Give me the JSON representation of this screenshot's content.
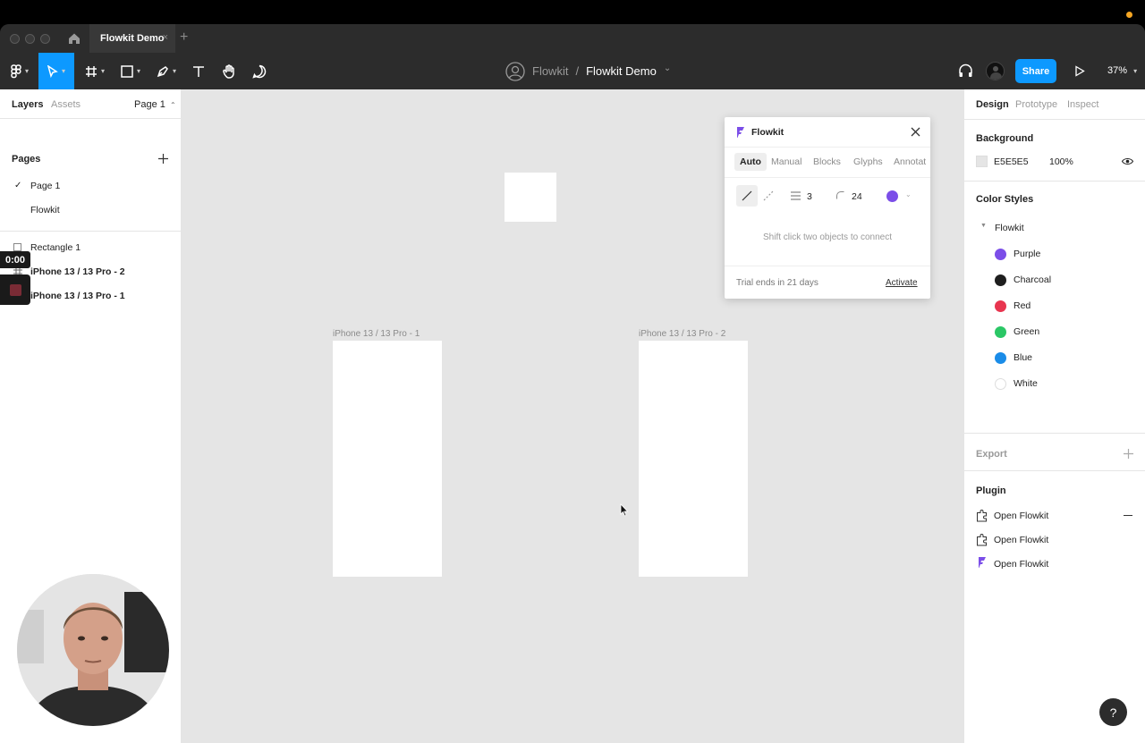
{
  "app": {
    "tab_title": "Flowkit Demo",
    "tab_close": "×",
    "new_tab": "+"
  },
  "toolbar": {
    "project": "Flowkit",
    "separator": "/",
    "file": "Flowkit Demo",
    "caret": "⌄",
    "share_label": "Share",
    "zoom": "37%"
  },
  "left_panel": {
    "tabs": {
      "layers": "Layers",
      "assets": "Assets",
      "page_selector": "Page 1"
    },
    "pages_title": "Pages",
    "pages": [
      {
        "label": "Page 1",
        "checked": true
      },
      {
        "label": "Flowkit",
        "checked": false
      }
    ],
    "layers": [
      {
        "label": "Rectangle 1",
        "type": "rectangle",
        "bold": false
      },
      {
        "label": "iPhone 13 / 13 Pro - 2",
        "type": "frame",
        "bold": true
      },
      {
        "label": "iPhone 13 / 13 Pro - 1",
        "type": "frame",
        "bold": true
      }
    ]
  },
  "canvas": {
    "background": "#E5E5E5",
    "frames": [
      {
        "label": "iPhone 13 / 13 Pro - 1"
      },
      {
        "label": "iPhone 13 / 13 Pro - 2"
      }
    ]
  },
  "plugin": {
    "title": "Flowkit",
    "tabs": [
      "Auto",
      "Manual",
      "Blocks",
      "Glyphs",
      "Annotat"
    ],
    "active_tab": "Auto",
    "stroke_width": "3",
    "corner_radius": "24",
    "connector_color": "#7B4EE8",
    "hint": "Shift click two objects to connect",
    "trial": "Trial ends in 21 days",
    "activate": "Activate"
  },
  "right_panel": {
    "tabs": {
      "design": "Design",
      "prototype": "Prototype",
      "inspect": "Inspect"
    },
    "background_title": "Background",
    "background_hex": "E5E5E5",
    "background_opacity": "100%",
    "color_styles_title": "Color Styles",
    "color_group": "Flowkit",
    "colors": [
      {
        "name": "Purple",
        "hex": "#7B4EE8"
      },
      {
        "name": "Charcoal",
        "hex": "#1E1E1E"
      },
      {
        "name": "Red",
        "hex": "#E8354F"
      },
      {
        "name": "Green",
        "hex": "#2BC766"
      },
      {
        "name": "Blue",
        "hex": "#1A8CE8"
      },
      {
        "name": "White",
        "hex": "#FFFFFF"
      }
    ],
    "export_title": "Export",
    "plugin_title": "Plugin",
    "plugin_items": [
      {
        "label": "Open Flowkit",
        "icon": "plugin-icon"
      },
      {
        "label": "Open Flowkit",
        "icon": "plugin-icon"
      },
      {
        "label": "Open Flowkit",
        "icon": "flowkit-logo-icon"
      }
    ]
  },
  "overlay": {
    "timer": "0:00",
    "help": "?"
  }
}
